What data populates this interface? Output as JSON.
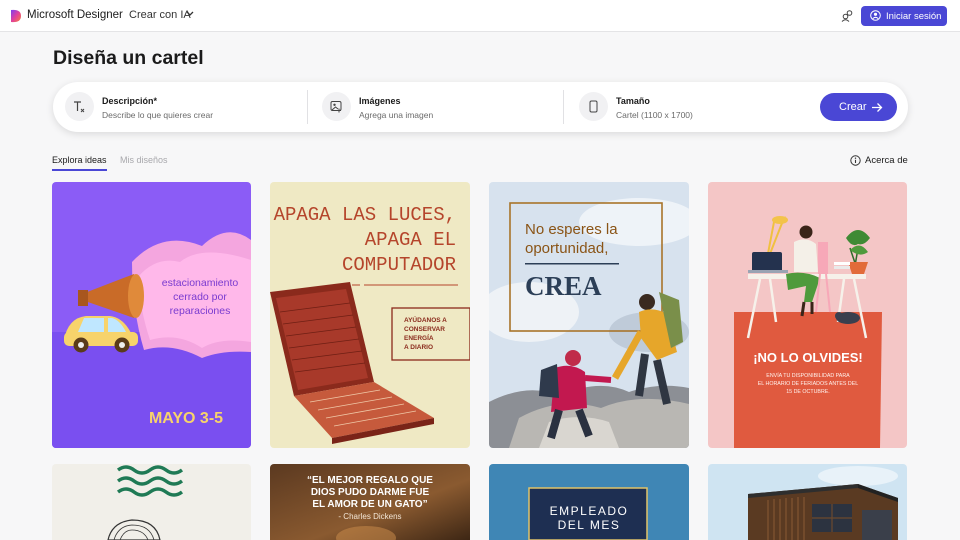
{
  "header": {
    "brand": "Microsoft Designer",
    "create_menu": "Crear con IA",
    "signin_label": "Iniciar sesión"
  },
  "page": {
    "title": "Diseña un cartel"
  },
  "prompt": {
    "description": {
      "label": "Descripción*",
      "hint": "Describe lo que quieres crear"
    },
    "images": {
      "label": "Imágenes",
      "hint": "Agrega una imagen"
    },
    "size": {
      "label": "Tamaño",
      "hint": "Cartel (1100 x 1700)"
    },
    "create_label": "Crear"
  },
  "tabs": [
    {
      "label": "Explora ideas",
      "active": true
    },
    {
      "label": "Mis diseños",
      "active": false
    }
  ],
  "about_label": "Acerca de",
  "cards": [
    {
      "lines": [
        "estacionamiento",
        "cerrado por",
        "reparaciones"
      ],
      "date": "MAYO 3-5"
    },
    {
      "title": [
        "APAGA LAS LUCES,",
        "APAGA EL",
        "COMPUTADOR"
      ],
      "note": [
        "AYÚDANOS A",
        "CONSERVAR",
        "ENERGÍA",
        "A DIARIO"
      ]
    },
    {
      "lines": [
        "No esperes la",
        "oportunidad,"
      ],
      "big": "CREA"
    },
    {
      "title": "¡NO LO OLVIDES!",
      "body": [
        "ENVÍA TU DISPONIBILIDAD PARA",
        "EL HORARIO DE FERIADOS ANTES DEL",
        "15 DE OCTUBRE."
      ]
    },
    {},
    {
      "quote": [
        "“EL MEJOR REGALO QUE",
        "DIOS PUDO DARME FUE",
        "EL AMOR DE UN GATO”"
      ],
      "author": "- Charles Dickens"
    },
    {
      "lines": [
        "EMPLEADO",
        "DEL MES"
      ]
    },
    {}
  ],
  "colors": {
    "accent": "#4a47d5",
    "card1_bg": "#8b5cf6",
    "card4_red": "#e05a3f"
  }
}
